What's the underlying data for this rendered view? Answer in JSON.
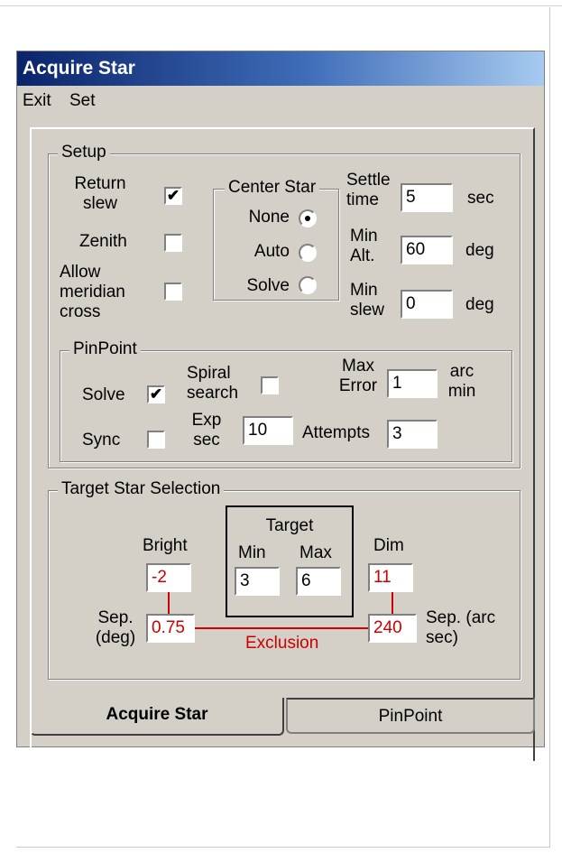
{
  "window": {
    "title": "Acquire Star"
  },
  "menu": {
    "exit": "Exit",
    "set": "Set"
  },
  "setup": {
    "legend": "Setup",
    "return_slew": {
      "label": "Return slew",
      "checked": true
    },
    "zenith": {
      "label": "Zenith",
      "checked": false
    },
    "allow_meridian": {
      "label": "Allow meridian cross",
      "checked": false
    },
    "center_star": {
      "legend": "Center Star",
      "options": [
        "None",
        "Auto",
        "Solve"
      ],
      "selected": "None"
    },
    "settle_time": {
      "label": "Settle time",
      "value": "5",
      "unit": "sec"
    },
    "min_alt": {
      "label": "Min Alt.",
      "value": "60",
      "unit": "deg"
    },
    "min_slew": {
      "label": "Min slew",
      "value": "0",
      "unit": "deg"
    }
  },
  "pinpoint": {
    "legend": "PinPoint",
    "solve": {
      "label": "Solve",
      "checked": true
    },
    "sync": {
      "label": "Sync",
      "checked": false
    },
    "spiral_search": {
      "label": "Spiral search",
      "checked": false
    },
    "exp_sec": {
      "label": "Exp sec",
      "value": "10"
    },
    "max_error": {
      "label": "Max Error",
      "value": "1",
      "unit": "arc min"
    },
    "attempts": {
      "label": "Attempts",
      "value": "3"
    }
  },
  "target": {
    "legend": "Target Star Selection",
    "bright_label": "Bright",
    "bright_value": "-2",
    "dim_label": "Dim",
    "dim_value": "11",
    "target_label": "Target",
    "min_label": "Min",
    "min_value": "3",
    "max_label": "Max",
    "max_value": "6",
    "sep_deg_label": "Sep. (deg)",
    "sep_deg_value": "0.75",
    "sep_arc_label": "Sep. (arc sec)",
    "sep_arc_value": "240",
    "exclusion_label": "Exclusion"
  },
  "tabs": {
    "acquire": "Acquire Star",
    "pinpoint": "PinPoint",
    "active": "Acquire Star"
  },
  "colors": {
    "title_start": "#0a246a",
    "title_end": "#a6caf0",
    "face": "#d4d0c8",
    "red": "#cc0000"
  }
}
